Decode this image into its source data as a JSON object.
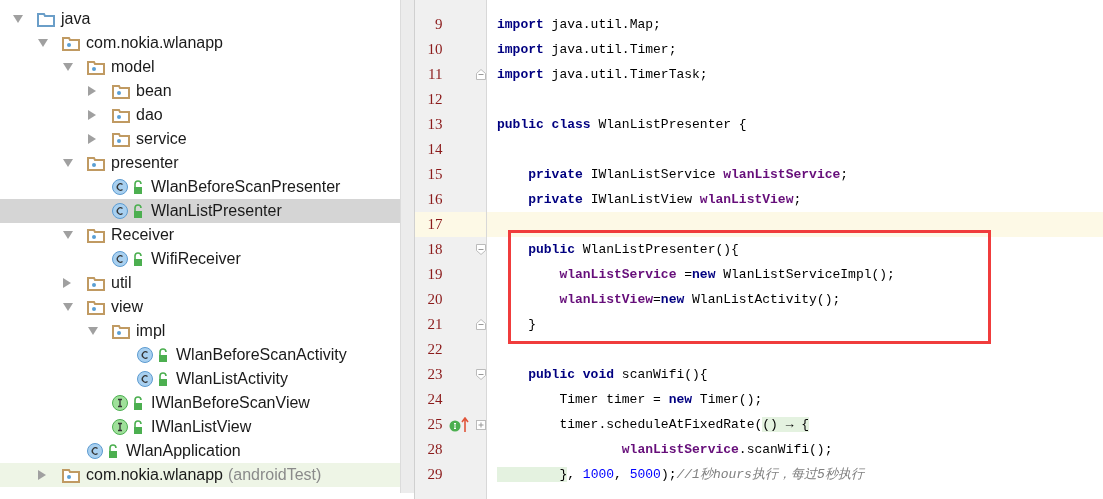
{
  "project_tree": [
    {
      "label": "java",
      "kind": "source-folder",
      "expanded": true,
      "selected": false,
      "children": [
        {
          "label": "com.nokia.wlanapp",
          "kind": "package",
          "expanded": true,
          "selected": false,
          "children": [
            {
              "label": "model",
              "kind": "package",
              "expanded": true,
              "selected": false,
              "children": [
                {
                  "label": "bean",
                  "kind": "package",
                  "expanded": false,
                  "selected": false
                },
                {
                  "label": "dao",
                  "kind": "package",
                  "expanded": false,
                  "selected": false
                },
                {
                  "label": "service",
                  "kind": "package",
                  "expanded": false,
                  "selected": false
                }
              ]
            },
            {
              "label": "presenter",
              "kind": "package",
              "expanded": true,
              "selected": false,
              "children": [
                {
                  "label": "WlanBeforeScanPresenter",
                  "kind": "class",
                  "selected": false
                },
                {
                  "label": "WlanListPresenter",
                  "kind": "class",
                  "selected": true
                }
              ]
            },
            {
              "label": "Receiver",
              "kind": "package",
              "expanded": true,
              "selected": false,
              "children": [
                {
                  "label": "WifiReceiver",
                  "kind": "class",
                  "selected": false
                }
              ]
            },
            {
              "label": "util",
              "kind": "package",
              "expanded": false,
              "selected": false
            },
            {
              "label": "view",
              "kind": "package",
              "expanded": true,
              "selected": false,
              "children": [
                {
                  "label": "impl",
                  "kind": "package",
                  "expanded": true,
                  "selected": false,
                  "children": [
                    {
                      "label": "WlanBeforeScanActivity",
                      "kind": "class",
                      "selected": false
                    },
                    {
                      "label": "WlanListActivity",
                      "kind": "class",
                      "selected": false
                    }
                  ]
                },
                {
                  "label": "IWlanBeforeScanView",
                  "kind": "interface",
                  "selected": false
                },
                {
                  "label": "IWlanListView",
                  "kind": "interface",
                  "selected": false
                }
              ]
            },
            {
              "label": "WlanApplication",
              "kind": "class",
              "selected": false
            }
          ]
        },
        {
          "label": "com.nokia.wlanapp",
          "note": "(androidTest)",
          "kind": "package",
          "expanded": false,
          "selected": false,
          "test": true
        }
      ]
    }
  ],
  "editor": {
    "lines": [
      {
        "number": "9",
        "tokens": [
          {
            "kind": "keyword",
            "text": "import"
          },
          {
            "kind": "plain",
            "text": " java.util.Map;"
          }
        ]
      },
      {
        "number": "10",
        "tokens": [
          {
            "kind": "keyword",
            "text": "import"
          },
          {
            "kind": "plain",
            "text": " java.util.Timer;"
          }
        ]
      },
      {
        "number": "11",
        "fold_end": true,
        "tokens": [
          {
            "kind": "keyword",
            "text": "import"
          },
          {
            "kind": "plain",
            "text": " java.util.TimerTask;"
          }
        ]
      },
      {
        "number": "12"
      },
      {
        "number": "13",
        "tokens": [
          {
            "kind": "keyword",
            "text": "public class"
          },
          {
            "kind": "plain",
            "text": " WlanListPresenter {"
          }
        ]
      },
      {
        "number": "14"
      },
      {
        "number": "15",
        "tokens": [
          {
            "kind": "keyword",
            "text": "    private"
          },
          {
            "kind": "plain",
            "text": " IWlanListService "
          },
          {
            "kind": "field",
            "text": "wlanListService"
          },
          {
            "kind": "plain",
            "text": ";"
          }
        ]
      },
      {
        "number": "16",
        "tokens": [
          {
            "kind": "keyword",
            "text": "    private"
          },
          {
            "kind": "plain",
            "text": " IWlanListView "
          },
          {
            "kind": "field",
            "text": "wlanListView"
          },
          {
            "kind": "plain",
            "text": ";"
          }
        ]
      },
      {
        "number": "17",
        "current": true
      },
      {
        "number": "18",
        "fold_start": true,
        "boxed": true,
        "tokens": [
          {
            "kind": "keyword",
            "text": "    public"
          },
          {
            "kind": "plain",
            "text": " WlanListPresenter(){"
          }
        ]
      },
      {
        "number": "19",
        "boxed": true,
        "tokens": [
          {
            "kind": "field",
            "text": "        wlanListService"
          },
          {
            "kind": "plain",
            "text": " ="
          },
          {
            "kind": "keyword",
            "text": "new"
          },
          {
            "kind": "plain",
            "text": " WlanListServiceImpl();"
          }
        ]
      },
      {
        "number": "20",
        "boxed": true,
        "tokens": [
          {
            "kind": "field",
            "text": "        wlanListView"
          },
          {
            "kind": "plain",
            "text": "="
          },
          {
            "kind": "keyword",
            "text": "new"
          },
          {
            "kind": "plain",
            "text": " WlanListActivity();"
          }
        ]
      },
      {
        "number": "21",
        "fold_end": true,
        "boxed": true,
        "tokens": [
          {
            "kind": "plain",
            "text": "    }"
          }
        ]
      },
      {
        "number": "22"
      },
      {
        "number": "23",
        "fold_start": true,
        "tokens": [
          {
            "kind": "keyword",
            "text": "    public void"
          },
          {
            "kind": "plain",
            "text": " scanWifi(){"
          }
        ]
      },
      {
        "number": "24",
        "tokens": [
          {
            "kind": "plain",
            "text": "        Timer timer = "
          },
          {
            "kind": "keyword",
            "text": "new"
          },
          {
            "kind": "plain",
            "text": " Timer();"
          }
        ]
      },
      {
        "number": "25",
        "collapsed": true,
        "implements": true,
        "tokens": [
          {
            "kind": "plain",
            "text": "        timer.scheduleAtFixedRate("
          },
          {
            "kind": "folded",
            "text": "() → {"
          }
        ]
      },
      {
        "number": "28",
        "tokens": [
          {
            "kind": "field",
            "text": "                wlanListService"
          },
          {
            "kind": "plain",
            "text": ".scanWifi();"
          }
        ]
      },
      {
        "number": "29",
        "tokens": [
          {
            "kind": "folded",
            "text": "        }"
          },
          {
            "kind": "plain",
            "text": ", "
          },
          {
            "kind": "number",
            "text": "1000"
          },
          {
            "kind": "plain",
            "text": ", "
          },
          {
            "kind": "number",
            "text": "5000"
          },
          {
            "kind": "plain",
            "text": ");"
          },
          {
            "kind": "comment",
            "text": "//1秒hours执行，每过5秒执行"
          }
        ]
      }
    ]
  }
}
